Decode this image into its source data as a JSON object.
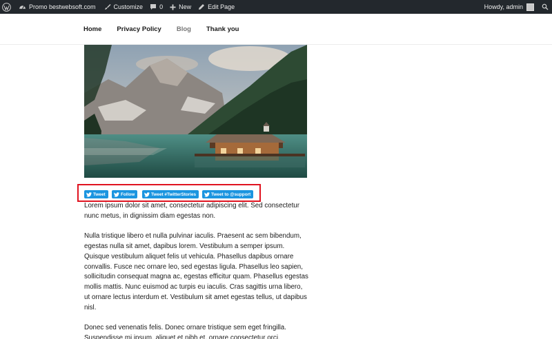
{
  "admin_bar": {
    "wordpress_icon": "wordpress-logo-icon",
    "site_name": "Promo bestwebsoft.com",
    "customize": "Customize",
    "comments_count": "0",
    "new": "New",
    "edit_page": "Edit Page",
    "howdy": "Howdy, admin",
    "colors": {
      "background": "#23282d",
      "text": "#eeeeee"
    }
  },
  "nav": {
    "items": [
      {
        "label": "Home",
        "active": false
      },
      {
        "label": "Privacy Policy",
        "active": false
      },
      {
        "label": "Blog",
        "active": true
      },
      {
        "label": "Thank you",
        "active": false
      }
    ]
  },
  "featured_image": {
    "icon": "mountain-lake-boathouse-photo"
  },
  "tweet_buttons": {
    "highlight_color": "#e0121f",
    "button_color": "#1b95e0",
    "items": [
      {
        "label": "Tweet"
      },
      {
        "label": "Follow"
      },
      {
        "label": "Tweet #TwitterStories"
      },
      {
        "label": "Tweet to @support"
      }
    ]
  },
  "content": {
    "paragraphs": [
      "Lorem ipsum dolor sit amet, consectetur adipiscing elit. Sed consectetur nunc metus, in dignissim diam egestas non.",
      "Nulla tristique libero et nulla pulvinar iaculis. Praesent ac sem bibendum, egestas nulla sit amet, dapibus lorem. Vestibulum a semper ipsum. Quisque vestibulum aliquet felis ut vehicula. Phasellus dapibus ornare convallis. Fusce nec ornare leo, sed egestas ligula. Phasellus leo sapien, sollicitudin consequat magna ac, egestas efficitur quam. Phasellus egestas mollis mattis. Nunc euismod ac turpis eu iaculis. Cras sagittis urna libero, ut ornare lectus interdum et. Vestibulum sit amet egestas tellus, ut dapibus nisl.",
      "Donec sed venenatis felis. Donec ornare tristique sem eget fringilla. Suspendisse mi ipsum, aliquet et nibh et, ornare consectetur orci."
    ]
  }
}
